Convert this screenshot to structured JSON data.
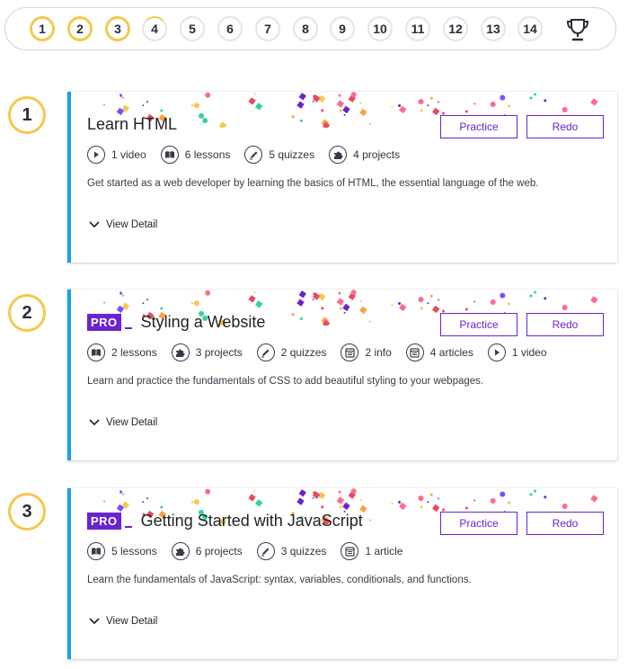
{
  "progress": {
    "steps": [
      {
        "label": "1",
        "state": "done"
      },
      {
        "label": "2",
        "state": "done"
      },
      {
        "label": "3",
        "state": "done"
      },
      {
        "label": "4",
        "state": "partial"
      },
      {
        "label": "5",
        "state": "todo"
      },
      {
        "label": "6",
        "state": "todo"
      },
      {
        "label": "7",
        "state": "todo"
      },
      {
        "label": "8",
        "state": "todo"
      },
      {
        "label": "9",
        "state": "todo"
      },
      {
        "label": "10",
        "state": "todo"
      },
      {
        "label": "11",
        "state": "todo"
      },
      {
        "label": "12",
        "state": "todo"
      },
      {
        "label": "13",
        "state": "todo"
      },
      {
        "label": "14",
        "state": "todo"
      }
    ],
    "trophy_icon": "trophy-icon"
  },
  "colors": {
    "accent": "#6a23d0",
    "gold": "#f5c84b",
    "card_border": "#1aa1f0"
  },
  "modules": [
    {
      "number": "1",
      "title": "Learn HTML",
      "pro": false,
      "pro_label": "",
      "practice_label": "Practice",
      "redo_label": "Redo",
      "stats": [
        {
          "icon": "play-icon",
          "text": "1 video"
        },
        {
          "icon": "book-icon",
          "text": "6 lessons"
        },
        {
          "icon": "pencil-icon",
          "text": "5 quizzes"
        },
        {
          "icon": "puzzle-icon",
          "text": "4 projects"
        }
      ],
      "description": "Get started as a web developer by learning the basics of HTML, the essential language of the web.",
      "view_detail": "View Detail"
    },
    {
      "number": "2",
      "title": "Styling a Website",
      "pro": true,
      "pro_label": "PRO",
      "practice_label": "Practice",
      "redo_label": "Redo",
      "stats": [
        {
          "icon": "book-icon",
          "text": "2 lessons"
        },
        {
          "icon": "puzzle-icon",
          "text": "3 projects"
        },
        {
          "icon": "pencil-icon",
          "text": "2 quizzes"
        },
        {
          "icon": "article-icon",
          "text": "2 info"
        },
        {
          "icon": "article-icon",
          "text": "4 articles"
        },
        {
          "icon": "play-icon",
          "text": "1 video"
        }
      ],
      "description": "Learn and practice the fundamentals of CSS to add beautiful styling to your webpages.",
      "view_detail": "View Detail"
    },
    {
      "number": "3",
      "title": "Getting Started with JavaScript",
      "pro": true,
      "pro_label": "PRO",
      "practice_label": "Practice",
      "redo_label": "Redo",
      "stats": [
        {
          "icon": "book-icon",
          "text": "5 lessons"
        },
        {
          "icon": "puzzle-icon",
          "text": "6 projects"
        },
        {
          "icon": "pencil-icon",
          "text": "3 quizzes"
        },
        {
          "icon": "article-icon",
          "text": "1 article"
        }
      ],
      "description": "Learn the fundamentals of JavaScript: syntax, variables, conditionals, and functions.",
      "view_detail": "View Detail"
    }
  ]
}
